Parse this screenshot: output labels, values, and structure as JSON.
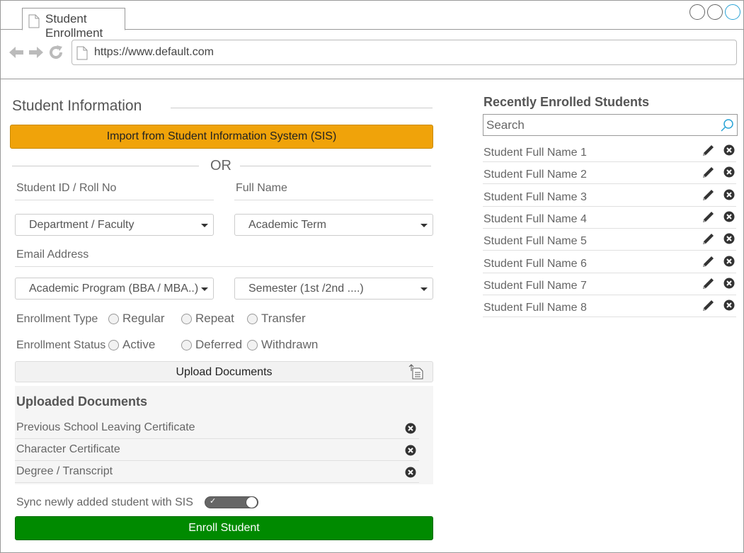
{
  "browser": {
    "tab_title": "Student Enrollment",
    "url": "https://www.default.com"
  },
  "form": {
    "section_title": "Student Information",
    "import_button": "Import from Student Information System (SIS)",
    "or_text": "OR",
    "student_id_label": "Student ID / Roll No",
    "full_name_label": "Full Name",
    "department_select": "Department / Faculty",
    "term_select": "Academic Term",
    "email_label": "Email Address",
    "program_select": "Academic Program (BBA / MBA..)",
    "semester_select": "Semester (1st /2nd ....)",
    "enrollment_type": {
      "label": "Enrollment Type",
      "options": [
        "Regular",
        "Repeat",
        "Transfer"
      ]
    },
    "enrollment_status": {
      "label": "Enrollment Status",
      "options": [
        "Active",
        "Deferred",
        "Withdrawn"
      ]
    },
    "upload_button": "Upload Documents",
    "uploaded_title": "Uploaded Documents",
    "documents": [
      "Previous School Leaving Certificate",
      "Character Certificate",
      "Degree / Transcript"
    ],
    "sync_label": "Sync newly added student with SIS",
    "sync_enabled": true,
    "enroll_button": "Enroll Student"
  },
  "recent": {
    "title": "Recently Enrolled Students",
    "search_placeholder": "Search",
    "students": [
      "Student Full Name 1",
      "Student Full Name 2",
      "Student Full Name 3",
      "Student Full Name 4",
      "Student Full Name 5",
      "Student Full Name 6",
      "Student Full Name 7",
      "Student Full Name 8"
    ]
  },
  "colors": {
    "import_button": "#f0a30a",
    "enroll_button": "#008a00",
    "search_icon": "#29a3d6"
  }
}
